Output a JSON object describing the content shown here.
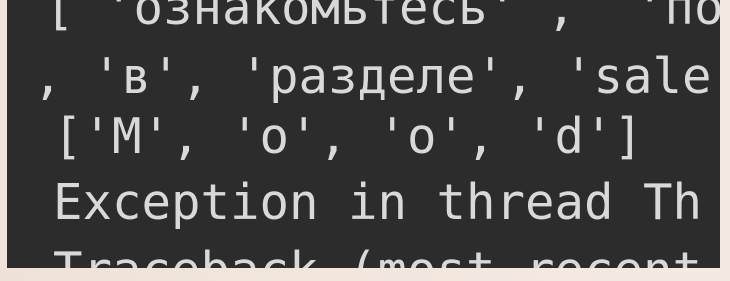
{
  "terminal": {
    "lines": [
      "[ 'ознакомьтесь' ,  'пожа",
      ", 'в', 'разделе', 'sale",
      "['M', 'o', 'o', 'd']",
      "Exception in thread Th",
      "Traceback (most recent"
    ]
  },
  "colors": {
    "terminal_background": "#2c2c2c",
    "text": "#d9d9d9",
    "frame": "#f3e6dc"
  }
}
